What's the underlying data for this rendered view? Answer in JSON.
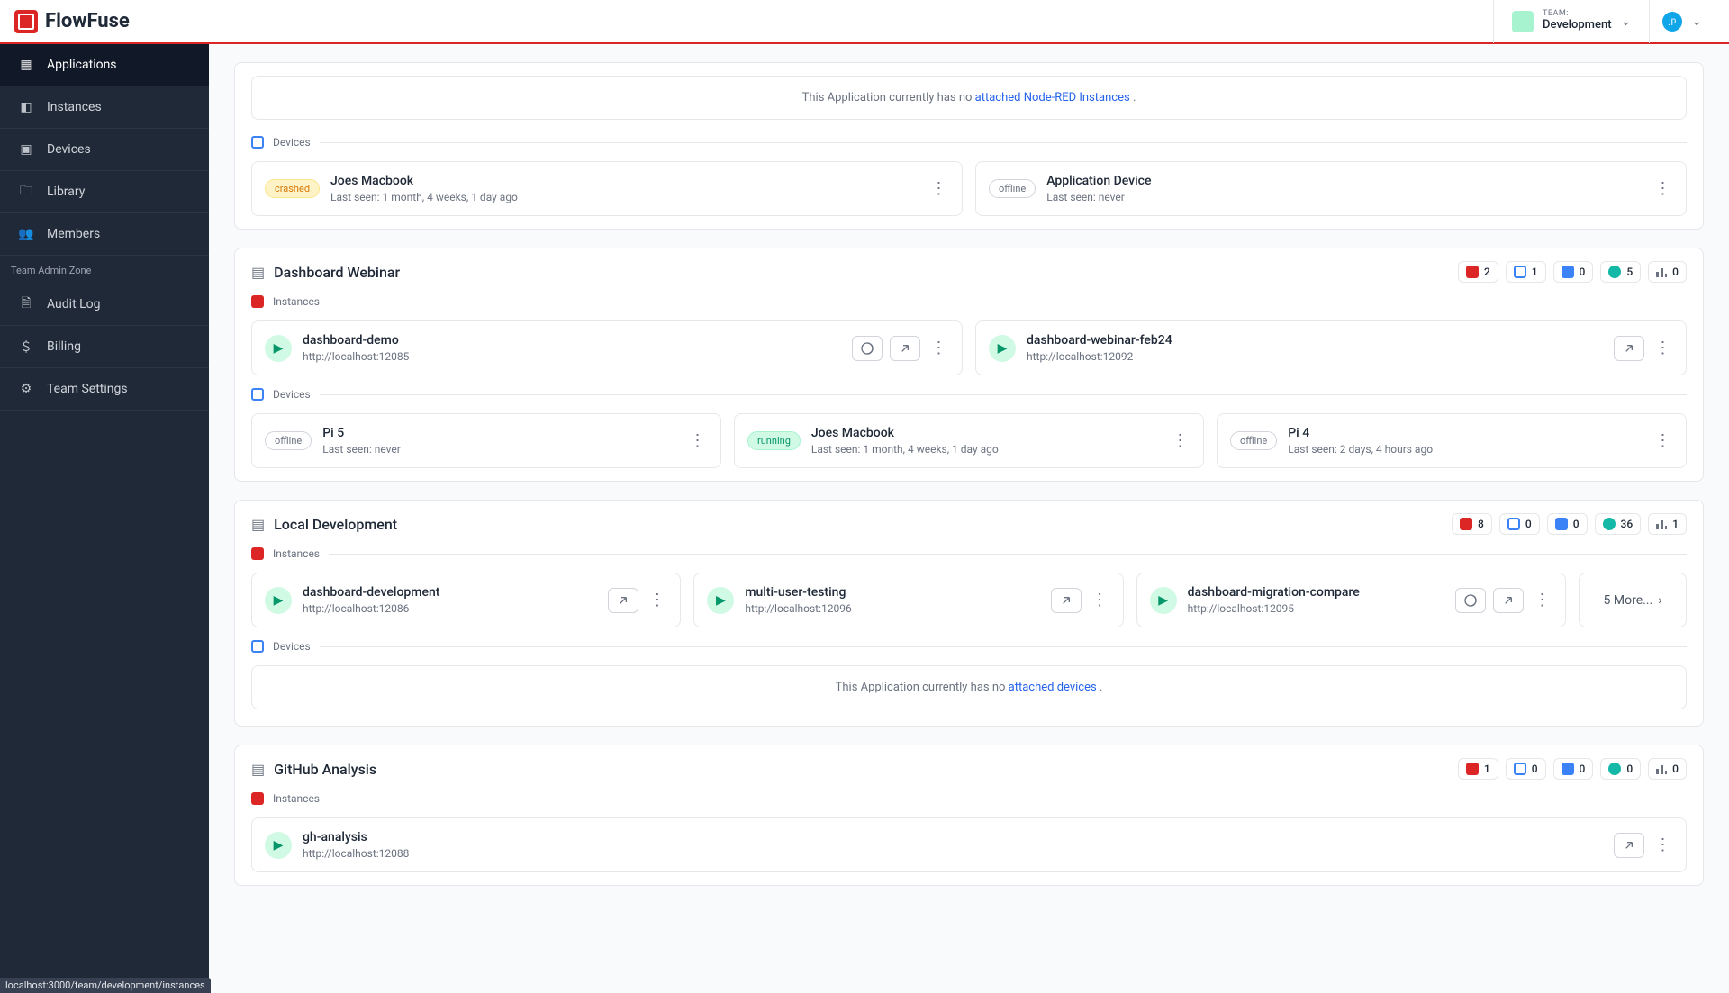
{
  "topbar": {
    "brand": "FlowFuse",
    "team_label": "TEAM:",
    "team_name": "Development",
    "user_initials": "jp"
  },
  "sidebar": {
    "items": [
      {
        "label": "Applications",
        "icon": "apps"
      },
      {
        "label": "Instances",
        "icon": "instances"
      },
      {
        "label": "Devices",
        "icon": "devices"
      },
      {
        "label": "Library",
        "icon": "library"
      },
      {
        "label": "Members",
        "icon": "members"
      }
    ],
    "zone_label": "Team Admin Zone",
    "admin_items": [
      {
        "label": "Audit Log",
        "icon": "audit"
      },
      {
        "label": "Billing",
        "icon": "billing"
      },
      {
        "label": "Team Settings",
        "icon": "settings"
      }
    ]
  },
  "apps": [
    {
      "empty_instances": "This Application currently has no ",
      "empty_instances_link": "attached Node-RED Instances",
      "devices": [
        {
          "status": "crashed",
          "status_label": "crashed",
          "name": "Joes Macbook",
          "sub": "Last seen: 1 month, 4 weeks, 1 day ago"
        },
        {
          "status": "offline",
          "status_label": "offline",
          "name": "Application Device",
          "sub": "Last seen: never"
        }
      ]
    },
    {
      "title": "Dashboard Webinar",
      "stats": {
        "a": "2",
        "b": "1",
        "c": "0",
        "d": "5",
        "e": "0"
      },
      "instances": [
        {
          "name": "dashboard-demo",
          "url": "http://localhost:12085",
          "dashboard": true
        },
        {
          "name": "dashboard-webinar-feb24",
          "url": "http://localhost:12092",
          "dashboard": false
        }
      ],
      "devices": [
        {
          "status": "offline",
          "status_label": "offline",
          "name": "Pi 5",
          "sub": "Last seen: never"
        },
        {
          "status": "running",
          "status_label": "running",
          "name": "Joes Macbook",
          "sub": "Last seen: 1 month, 4 weeks, 1 day ago"
        },
        {
          "status": "offline",
          "status_label": "offline",
          "name": "Pi 4",
          "sub": "Last seen: 2 days, 4 hours ago"
        }
      ]
    },
    {
      "title": "Local Development",
      "stats": {
        "a": "8",
        "b": "0",
        "c": "0",
        "d": "36",
        "e": "1"
      },
      "instances": [
        {
          "name": "dashboard-development",
          "url": "http://localhost:12086",
          "dashboard": false
        },
        {
          "name": "multi-user-testing",
          "url": "http://localhost:12096",
          "dashboard": false
        },
        {
          "name": "dashboard-migration-compare",
          "url": "http://localhost:12095",
          "dashboard": true
        }
      ],
      "more_label": "5 More...",
      "empty_devices": "This Application currently has no ",
      "empty_devices_link": "attached devices"
    },
    {
      "title": "GitHub Analysis",
      "stats": {
        "a": "1",
        "b": "0",
        "c": "0",
        "d": "0",
        "e": "0"
      },
      "instances": [
        {
          "name": "gh-analysis",
          "url": "http://localhost:12088",
          "dashboard": false
        }
      ]
    }
  ],
  "section_labels": {
    "instances": "Instances",
    "devices": "Devices"
  },
  "status_hint": "localhost:3000/team/development/instances"
}
